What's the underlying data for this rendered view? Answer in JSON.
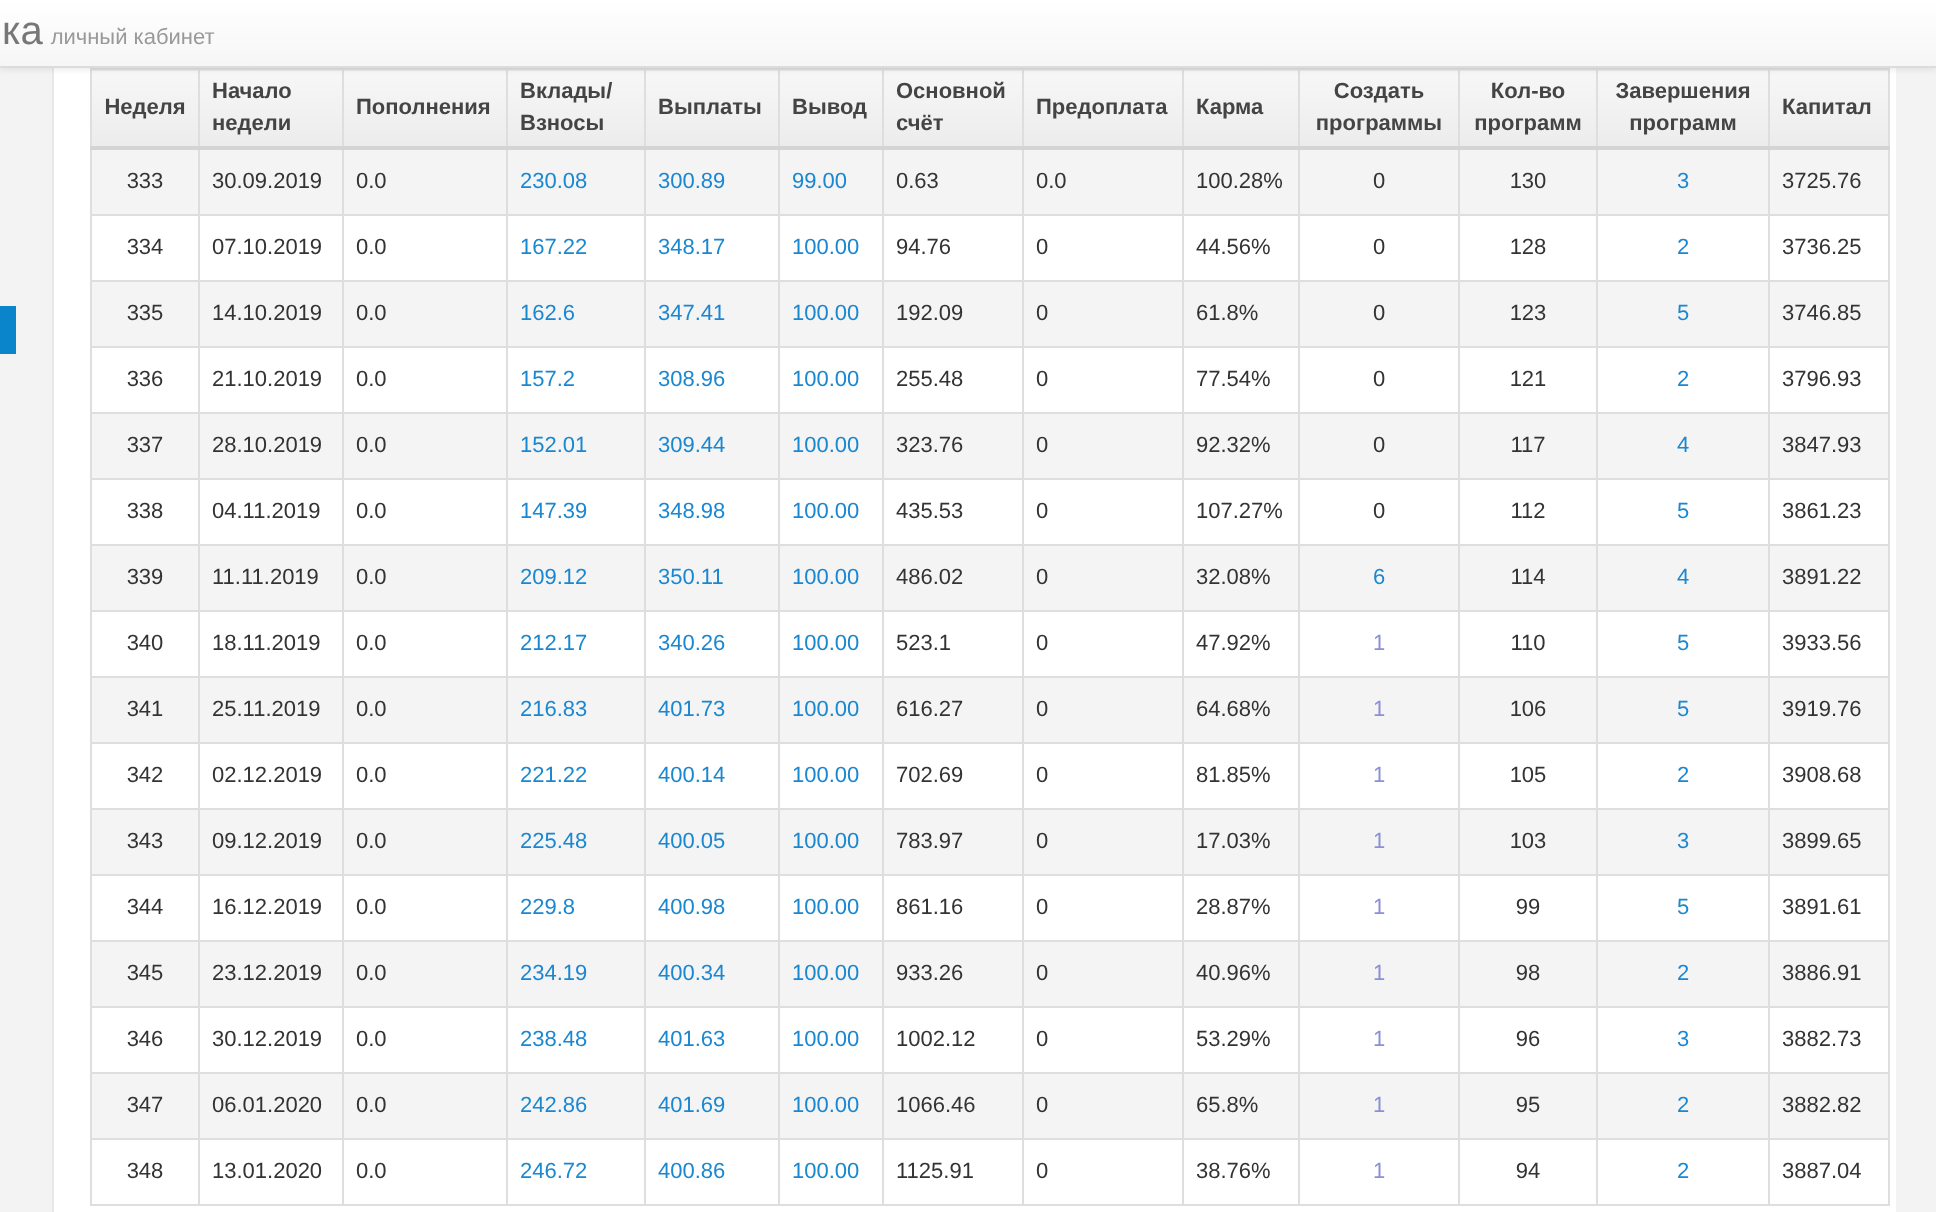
{
  "header": {
    "brand": "ка",
    "subtitle": "личный кабинет"
  },
  "sidebar": {
    "items": [
      {
        "selected": true
      }
    ]
  },
  "table": {
    "columns": [
      "Неделя",
      "Начало недели",
      "Пополнения",
      "Вклады/ Взносы",
      "Выплаты",
      "Вывод",
      "Основной счёт",
      "Предоплата",
      "Карма",
      "Создать программы",
      "Кол-во программ",
      "Завершения программ",
      "Капитал"
    ],
    "rows": [
      {
        "cells": [
          {
            "text": "333",
            "kind": "plain"
          },
          {
            "text": "30.09.2019",
            "kind": "plain"
          },
          {
            "text": "0.0",
            "kind": "plain"
          },
          {
            "text": "230.08",
            "kind": "link"
          },
          {
            "text": "300.89",
            "kind": "link"
          },
          {
            "text": "99.00",
            "kind": "link"
          },
          {
            "text": "0.63",
            "kind": "plain"
          },
          {
            "text": "0.0",
            "kind": "plain"
          },
          {
            "text": "100.28%",
            "kind": "plain"
          },
          {
            "text": "0",
            "kind": "plain"
          },
          {
            "text": "130",
            "kind": "plain"
          },
          {
            "text": "3",
            "kind": "link"
          },
          {
            "text": "3725.76",
            "kind": "plain"
          }
        ]
      },
      {
        "cells": [
          {
            "text": "334",
            "kind": "plain"
          },
          {
            "text": "07.10.2019",
            "kind": "plain"
          },
          {
            "text": "0.0",
            "kind": "plain"
          },
          {
            "text": "167.22",
            "kind": "link"
          },
          {
            "text": "348.17",
            "kind": "link"
          },
          {
            "text": "100.00",
            "kind": "link"
          },
          {
            "text": "94.76",
            "kind": "plain"
          },
          {
            "text": "0",
            "kind": "plain"
          },
          {
            "text": "44.56%",
            "kind": "plain"
          },
          {
            "text": "0",
            "kind": "plain"
          },
          {
            "text": "128",
            "kind": "plain"
          },
          {
            "text": "2",
            "kind": "link"
          },
          {
            "text": "3736.25",
            "kind": "plain"
          }
        ]
      },
      {
        "cells": [
          {
            "text": "335",
            "kind": "plain"
          },
          {
            "text": "14.10.2019",
            "kind": "plain"
          },
          {
            "text": "0.0",
            "kind": "plain"
          },
          {
            "text": "162.6",
            "kind": "link"
          },
          {
            "text": "347.41",
            "kind": "link"
          },
          {
            "text": "100.00",
            "kind": "link"
          },
          {
            "text": "192.09",
            "kind": "plain"
          },
          {
            "text": "0",
            "kind": "plain"
          },
          {
            "text": "61.8%",
            "kind": "plain"
          },
          {
            "text": "0",
            "kind": "plain"
          },
          {
            "text": "123",
            "kind": "plain"
          },
          {
            "text": "5",
            "kind": "link"
          },
          {
            "text": "3746.85",
            "kind": "plain"
          }
        ]
      },
      {
        "cells": [
          {
            "text": "336",
            "kind": "plain"
          },
          {
            "text": "21.10.2019",
            "kind": "plain"
          },
          {
            "text": "0.0",
            "kind": "plain"
          },
          {
            "text": "157.2",
            "kind": "link"
          },
          {
            "text": "308.96",
            "kind": "link"
          },
          {
            "text": "100.00",
            "kind": "link"
          },
          {
            "text": "255.48",
            "kind": "plain"
          },
          {
            "text": "0",
            "kind": "plain"
          },
          {
            "text": "77.54%",
            "kind": "plain"
          },
          {
            "text": "0",
            "kind": "plain"
          },
          {
            "text": "121",
            "kind": "plain"
          },
          {
            "text": "2",
            "kind": "link"
          },
          {
            "text": "3796.93",
            "kind": "plain"
          }
        ]
      },
      {
        "cells": [
          {
            "text": "337",
            "kind": "plain"
          },
          {
            "text": "28.10.2019",
            "kind": "plain"
          },
          {
            "text": "0.0",
            "kind": "plain"
          },
          {
            "text": "152.01",
            "kind": "link"
          },
          {
            "text": "309.44",
            "kind": "link"
          },
          {
            "text": "100.00",
            "kind": "link"
          },
          {
            "text": "323.76",
            "kind": "plain"
          },
          {
            "text": "0",
            "kind": "plain"
          },
          {
            "text": "92.32%",
            "kind": "plain"
          },
          {
            "text": "0",
            "kind": "plain"
          },
          {
            "text": "117",
            "kind": "plain"
          },
          {
            "text": "4",
            "kind": "link"
          },
          {
            "text": "3847.93",
            "kind": "plain"
          }
        ]
      },
      {
        "cells": [
          {
            "text": "338",
            "kind": "plain"
          },
          {
            "text": "04.11.2019",
            "kind": "plain"
          },
          {
            "text": "0.0",
            "kind": "plain"
          },
          {
            "text": "147.39",
            "kind": "link"
          },
          {
            "text": "348.98",
            "kind": "link"
          },
          {
            "text": "100.00",
            "kind": "link"
          },
          {
            "text": "435.53",
            "kind": "plain"
          },
          {
            "text": "0",
            "kind": "plain"
          },
          {
            "text": "107.27%",
            "kind": "plain"
          },
          {
            "text": "0",
            "kind": "plain"
          },
          {
            "text": "112",
            "kind": "plain"
          },
          {
            "text": "5",
            "kind": "link"
          },
          {
            "text": "3861.23",
            "kind": "plain"
          }
        ]
      },
      {
        "cells": [
          {
            "text": "339",
            "kind": "plain"
          },
          {
            "text": "11.11.2019",
            "kind": "plain"
          },
          {
            "text": "0.0",
            "kind": "plain"
          },
          {
            "text": "209.12",
            "kind": "link"
          },
          {
            "text": "350.11",
            "kind": "link"
          },
          {
            "text": "100.00",
            "kind": "link"
          },
          {
            "text": "486.02",
            "kind": "plain"
          },
          {
            "text": "0",
            "kind": "plain"
          },
          {
            "text": "32.08%",
            "kind": "plain"
          },
          {
            "text": "6",
            "kind": "link"
          },
          {
            "text": "114",
            "kind": "plain"
          },
          {
            "text": "4",
            "kind": "link"
          },
          {
            "text": "3891.22",
            "kind": "plain"
          }
        ]
      },
      {
        "cells": [
          {
            "text": "340",
            "kind": "plain"
          },
          {
            "text": "18.11.2019",
            "kind": "plain"
          },
          {
            "text": "0.0",
            "kind": "plain"
          },
          {
            "text": "212.17",
            "kind": "link"
          },
          {
            "text": "340.26",
            "kind": "link"
          },
          {
            "text": "100.00",
            "kind": "link"
          },
          {
            "text": "523.1",
            "kind": "plain"
          },
          {
            "text": "0",
            "kind": "plain"
          },
          {
            "text": "47.92%",
            "kind": "plain"
          },
          {
            "text": "1",
            "kind": "visited"
          },
          {
            "text": "110",
            "kind": "plain"
          },
          {
            "text": "5",
            "kind": "link"
          },
          {
            "text": "3933.56",
            "kind": "plain"
          }
        ]
      },
      {
        "cells": [
          {
            "text": "341",
            "kind": "plain"
          },
          {
            "text": "25.11.2019",
            "kind": "plain"
          },
          {
            "text": "0.0",
            "kind": "plain"
          },
          {
            "text": "216.83",
            "kind": "link"
          },
          {
            "text": "401.73",
            "kind": "link"
          },
          {
            "text": "100.00",
            "kind": "link"
          },
          {
            "text": "616.27",
            "kind": "plain"
          },
          {
            "text": "0",
            "kind": "plain"
          },
          {
            "text": "64.68%",
            "kind": "plain"
          },
          {
            "text": "1",
            "kind": "visited"
          },
          {
            "text": "106",
            "kind": "plain"
          },
          {
            "text": "5",
            "kind": "link"
          },
          {
            "text": "3919.76",
            "kind": "plain"
          }
        ]
      },
      {
        "cells": [
          {
            "text": "342",
            "kind": "plain"
          },
          {
            "text": "02.12.2019",
            "kind": "plain"
          },
          {
            "text": "0.0",
            "kind": "plain"
          },
          {
            "text": "221.22",
            "kind": "link"
          },
          {
            "text": "400.14",
            "kind": "link"
          },
          {
            "text": "100.00",
            "kind": "link"
          },
          {
            "text": "702.69",
            "kind": "plain"
          },
          {
            "text": "0",
            "kind": "plain"
          },
          {
            "text": "81.85%",
            "kind": "plain"
          },
          {
            "text": "1",
            "kind": "visited"
          },
          {
            "text": "105",
            "kind": "plain"
          },
          {
            "text": "2",
            "kind": "link"
          },
          {
            "text": "3908.68",
            "kind": "plain"
          }
        ]
      },
      {
        "cells": [
          {
            "text": "343",
            "kind": "plain"
          },
          {
            "text": "09.12.2019",
            "kind": "plain"
          },
          {
            "text": "0.0",
            "kind": "plain"
          },
          {
            "text": "225.48",
            "kind": "link"
          },
          {
            "text": "400.05",
            "kind": "link"
          },
          {
            "text": "100.00",
            "kind": "link"
          },
          {
            "text": "783.97",
            "kind": "plain"
          },
          {
            "text": "0",
            "kind": "plain"
          },
          {
            "text": "17.03%",
            "kind": "plain"
          },
          {
            "text": "1",
            "kind": "visited"
          },
          {
            "text": "103",
            "kind": "plain"
          },
          {
            "text": "3",
            "kind": "link"
          },
          {
            "text": "3899.65",
            "kind": "plain"
          }
        ]
      },
      {
        "cells": [
          {
            "text": "344",
            "kind": "plain"
          },
          {
            "text": "16.12.2019",
            "kind": "plain"
          },
          {
            "text": "0.0",
            "kind": "plain"
          },
          {
            "text": "229.8",
            "kind": "link"
          },
          {
            "text": "400.98",
            "kind": "link"
          },
          {
            "text": "100.00",
            "kind": "link"
          },
          {
            "text": "861.16",
            "kind": "plain"
          },
          {
            "text": "0",
            "kind": "plain"
          },
          {
            "text": "28.87%",
            "kind": "plain"
          },
          {
            "text": "1",
            "kind": "visited"
          },
          {
            "text": "99",
            "kind": "plain"
          },
          {
            "text": "5",
            "kind": "link"
          },
          {
            "text": "3891.61",
            "kind": "plain"
          }
        ]
      },
      {
        "cells": [
          {
            "text": "345",
            "kind": "plain"
          },
          {
            "text": "23.12.2019",
            "kind": "plain"
          },
          {
            "text": "0.0",
            "kind": "plain"
          },
          {
            "text": "234.19",
            "kind": "link"
          },
          {
            "text": "400.34",
            "kind": "link"
          },
          {
            "text": "100.00",
            "kind": "link"
          },
          {
            "text": "933.26",
            "kind": "plain"
          },
          {
            "text": "0",
            "kind": "plain"
          },
          {
            "text": "40.96%",
            "kind": "plain"
          },
          {
            "text": "1",
            "kind": "visited"
          },
          {
            "text": "98",
            "kind": "plain"
          },
          {
            "text": "2",
            "kind": "link"
          },
          {
            "text": "3886.91",
            "kind": "plain"
          }
        ]
      },
      {
        "cells": [
          {
            "text": "346",
            "kind": "plain"
          },
          {
            "text": "30.12.2019",
            "kind": "plain"
          },
          {
            "text": "0.0",
            "kind": "plain"
          },
          {
            "text": "238.48",
            "kind": "link"
          },
          {
            "text": "401.63",
            "kind": "link"
          },
          {
            "text": "100.00",
            "kind": "link"
          },
          {
            "text": "1002.12",
            "kind": "plain"
          },
          {
            "text": "0",
            "kind": "plain"
          },
          {
            "text": "53.29%",
            "kind": "plain"
          },
          {
            "text": "1",
            "kind": "visited"
          },
          {
            "text": "96",
            "kind": "plain"
          },
          {
            "text": "3",
            "kind": "link"
          },
          {
            "text": "3882.73",
            "kind": "plain"
          }
        ]
      },
      {
        "cells": [
          {
            "text": "347",
            "kind": "plain"
          },
          {
            "text": "06.01.2020",
            "kind": "plain"
          },
          {
            "text": "0.0",
            "kind": "plain"
          },
          {
            "text": "242.86",
            "kind": "link"
          },
          {
            "text": "401.69",
            "kind": "link"
          },
          {
            "text": "100.00",
            "kind": "link"
          },
          {
            "text": "1066.46",
            "kind": "plain"
          },
          {
            "text": "0",
            "kind": "plain"
          },
          {
            "text": "65.8%",
            "kind": "plain"
          },
          {
            "text": "1",
            "kind": "visited"
          },
          {
            "text": "95",
            "kind": "plain"
          },
          {
            "text": "2",
            "kind": "link"
          },
          {
            "text": "3882.82",
            "kind": "plain"
          }
        ]
      },
      {
        "cells": [
          {
            "text": "348",
            "kind": "plain"
          },
          {
            "text": "13.01.2020",
            "kind": "plain"
          },
          {
            "text": "0.0",
            "kind": "plain"
          },
          {
            "text": "246.72",
            "kind": "link"
          },
          {
            "text": "400.86",
            "kind": "link"
          },
          {
            "text": "100.00",
            "kind": "link"
          },
          {
            "text": "1125.91",
            "kind": "plain"
          },
          {
            "text": "0",
            "kind": "plain"
          },
          {
            "text": "38.76%",
            "kind": "plain"
          },
          {
            "text": "1",
            "kind": "visited"
          },
          {
            "text": "94",
            "kind": "plain"
          },
          {
            "text": "2",
            "kind": "link"
          },
          {
            "text": "3887.04",
            "kind": "plain"
          }
        ]
      }
    ]
  }
}
